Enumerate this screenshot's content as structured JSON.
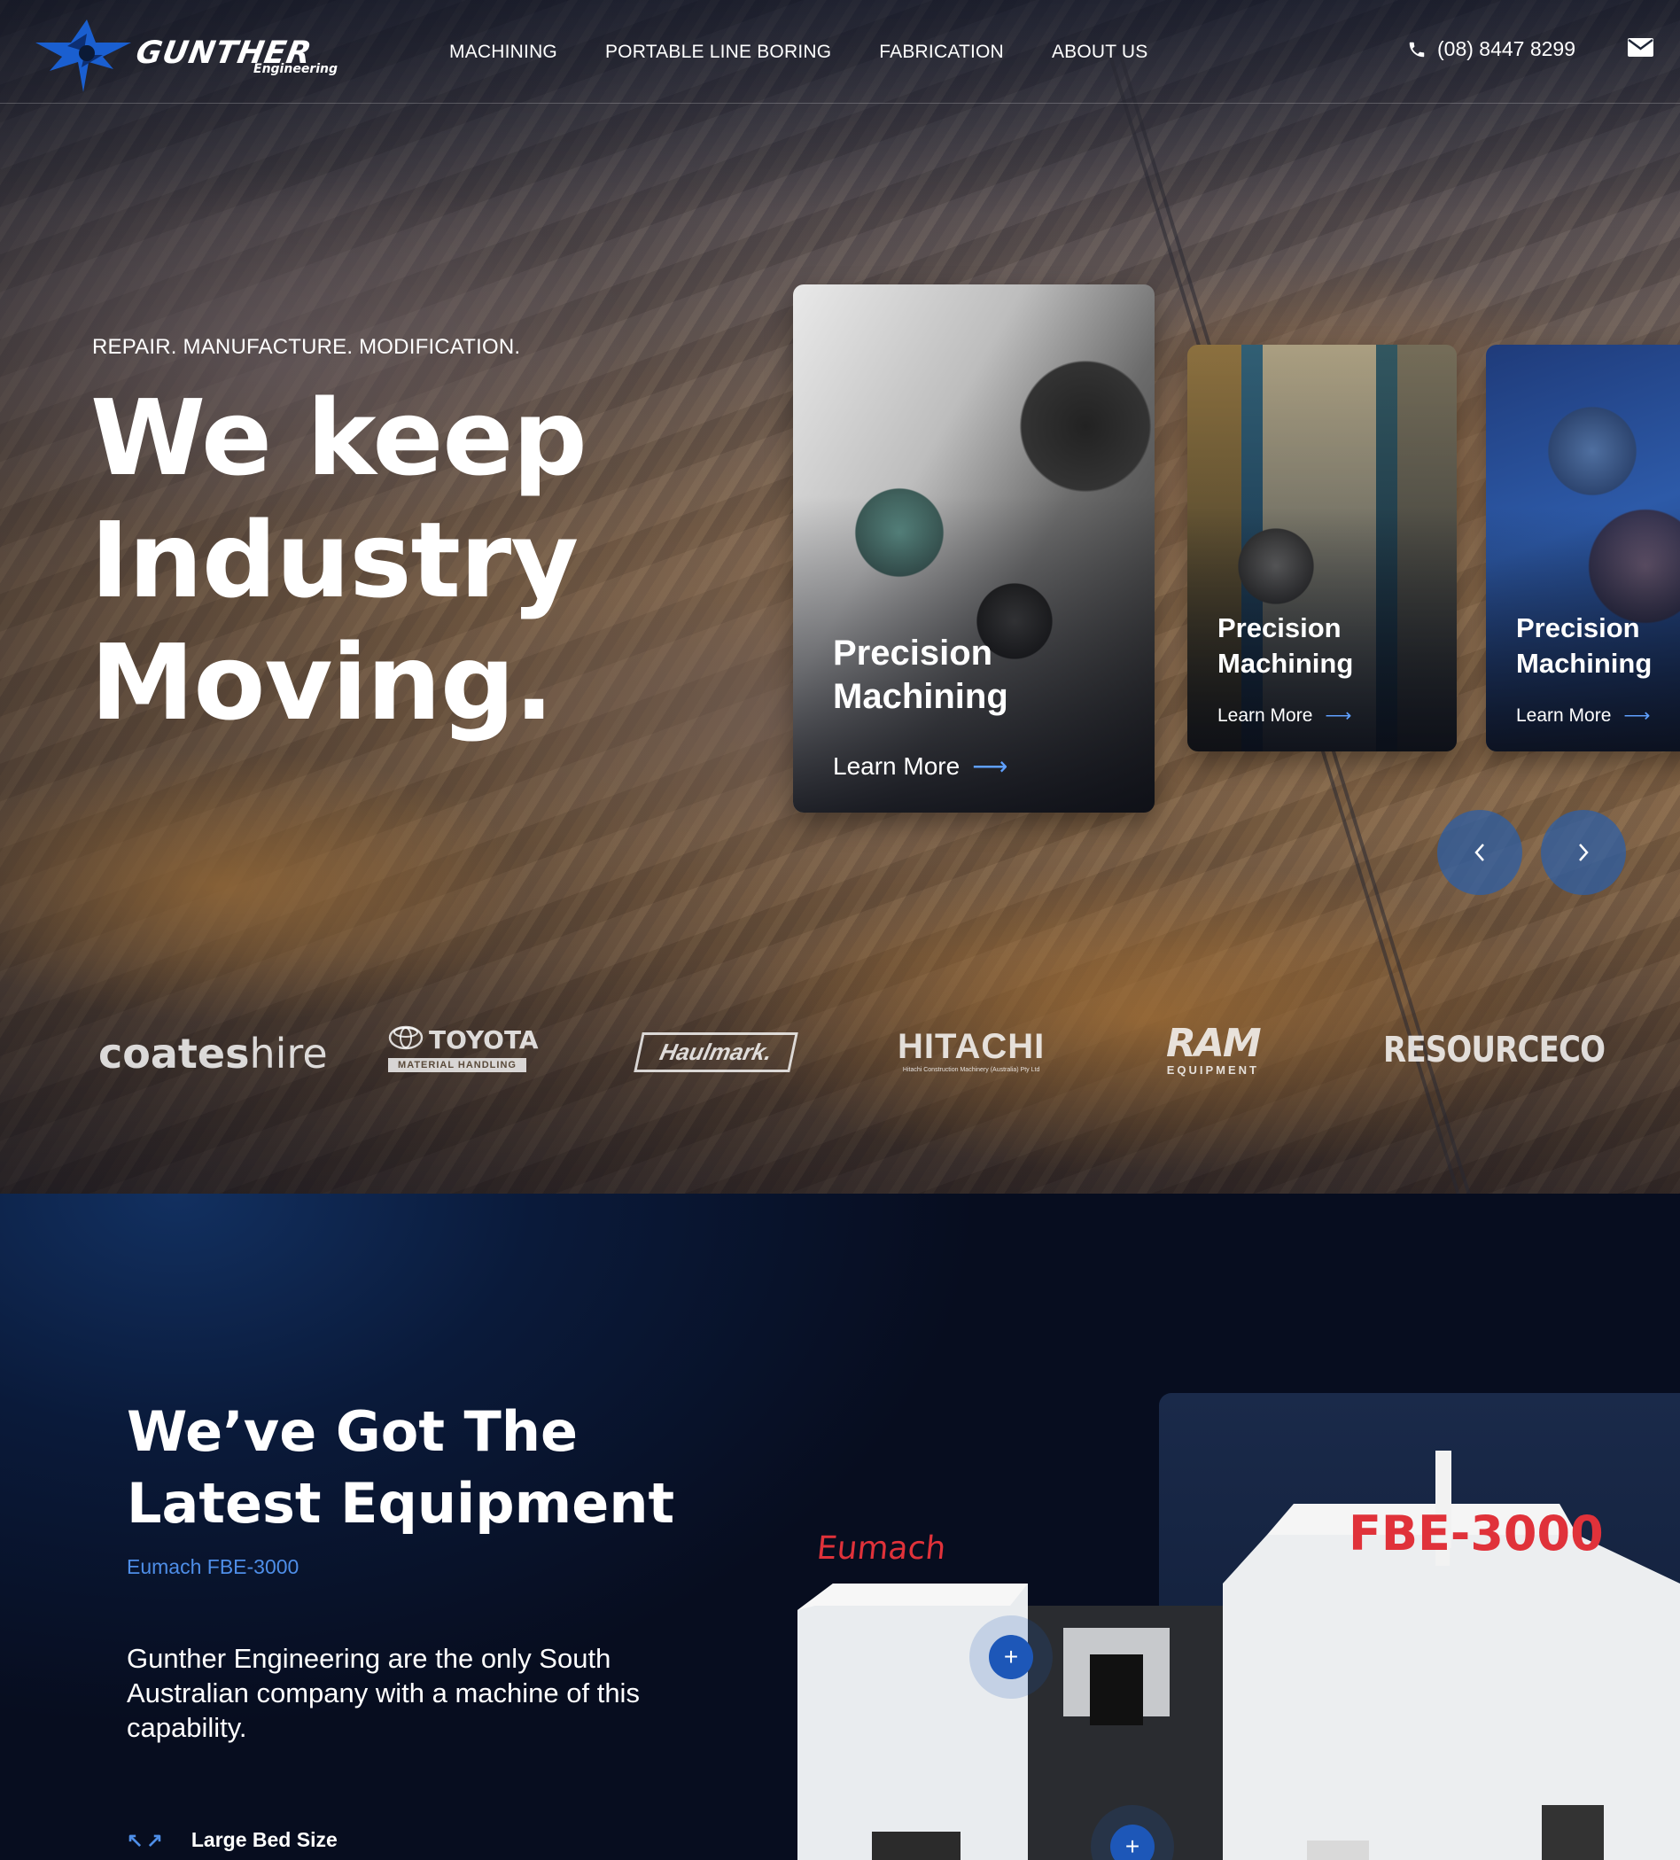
{
  "brand": {
    "name": "GUNTHER",
    "sub": "Engineering"
  },
  "nav": {
    "links": [
      "MACHINING",
      "PORTABLE LINE BORING",
      "FABRICATION",
      "ABOUT US"
    ],
    "phone": "(08) 8447 8299"
  },
  "hero": {
    "tagline": "REPAIR. MANUFACTURE. MODIFICATION.",
    "headline": [
      "We keep",
      "Industry",
      "Moving."
    ],
    "cards": [
      {
        "title_line1": "Precision",
        "title_line2": "Machining",
        "link": "Learn More"
      },
      {
        "title_line1": "Precision",
        "title_line2": "Machining",
        "link": "Learn More"
      },
      {
        "title_line1": "Precision",
        "title_line2": "Machining",
        "link": "Learn More"
      }
    ]
  },
  "clients": {
    "coates_a": "coates",
    "coates_b": "hire",
    "toyota": "TOYOTA",
    "toyota_sub": "MATERIAL HANDLING",
    "haulmark": "Haulmark.",
    "hitachi": "HITACHI",
    "hitachi_sub": "Hitachi Construction Machinery (Australia) Pty Ltd",
    "ram": "RAM",
    "ram_sub": "EQUIPMENT",
    "resourceco": "RESOURCECO"
  },
  "equipment": {
    "title_line1": "We’ve Got The",
    "title_line2": "Latest Equipment",
    "model": "Eumach FBE-3000",
    "description": "Gunther Engineering are the only South Australian company with a machine of this capability.",
    "feature": "Large Bed Size",
    "machine_brand": "Eumach",
    "machine_model": "FBE-3000"
  },
  "icons": {
    "phone": "phone-icon",
    "mail": "mail-icon",
    "arrow": "arrow-right-icon",
    "prev": "chevron-left-icon",
    "next": "chevron-right-icon",
    "plus": "plus-icon",
    "expand": "expand-arrows-icon"
  },
  "colors": {
    "accent": "#4e8ee8",
    "hotspot": "#1d57b8",
    "dark": "#0a1226"
  }
}
